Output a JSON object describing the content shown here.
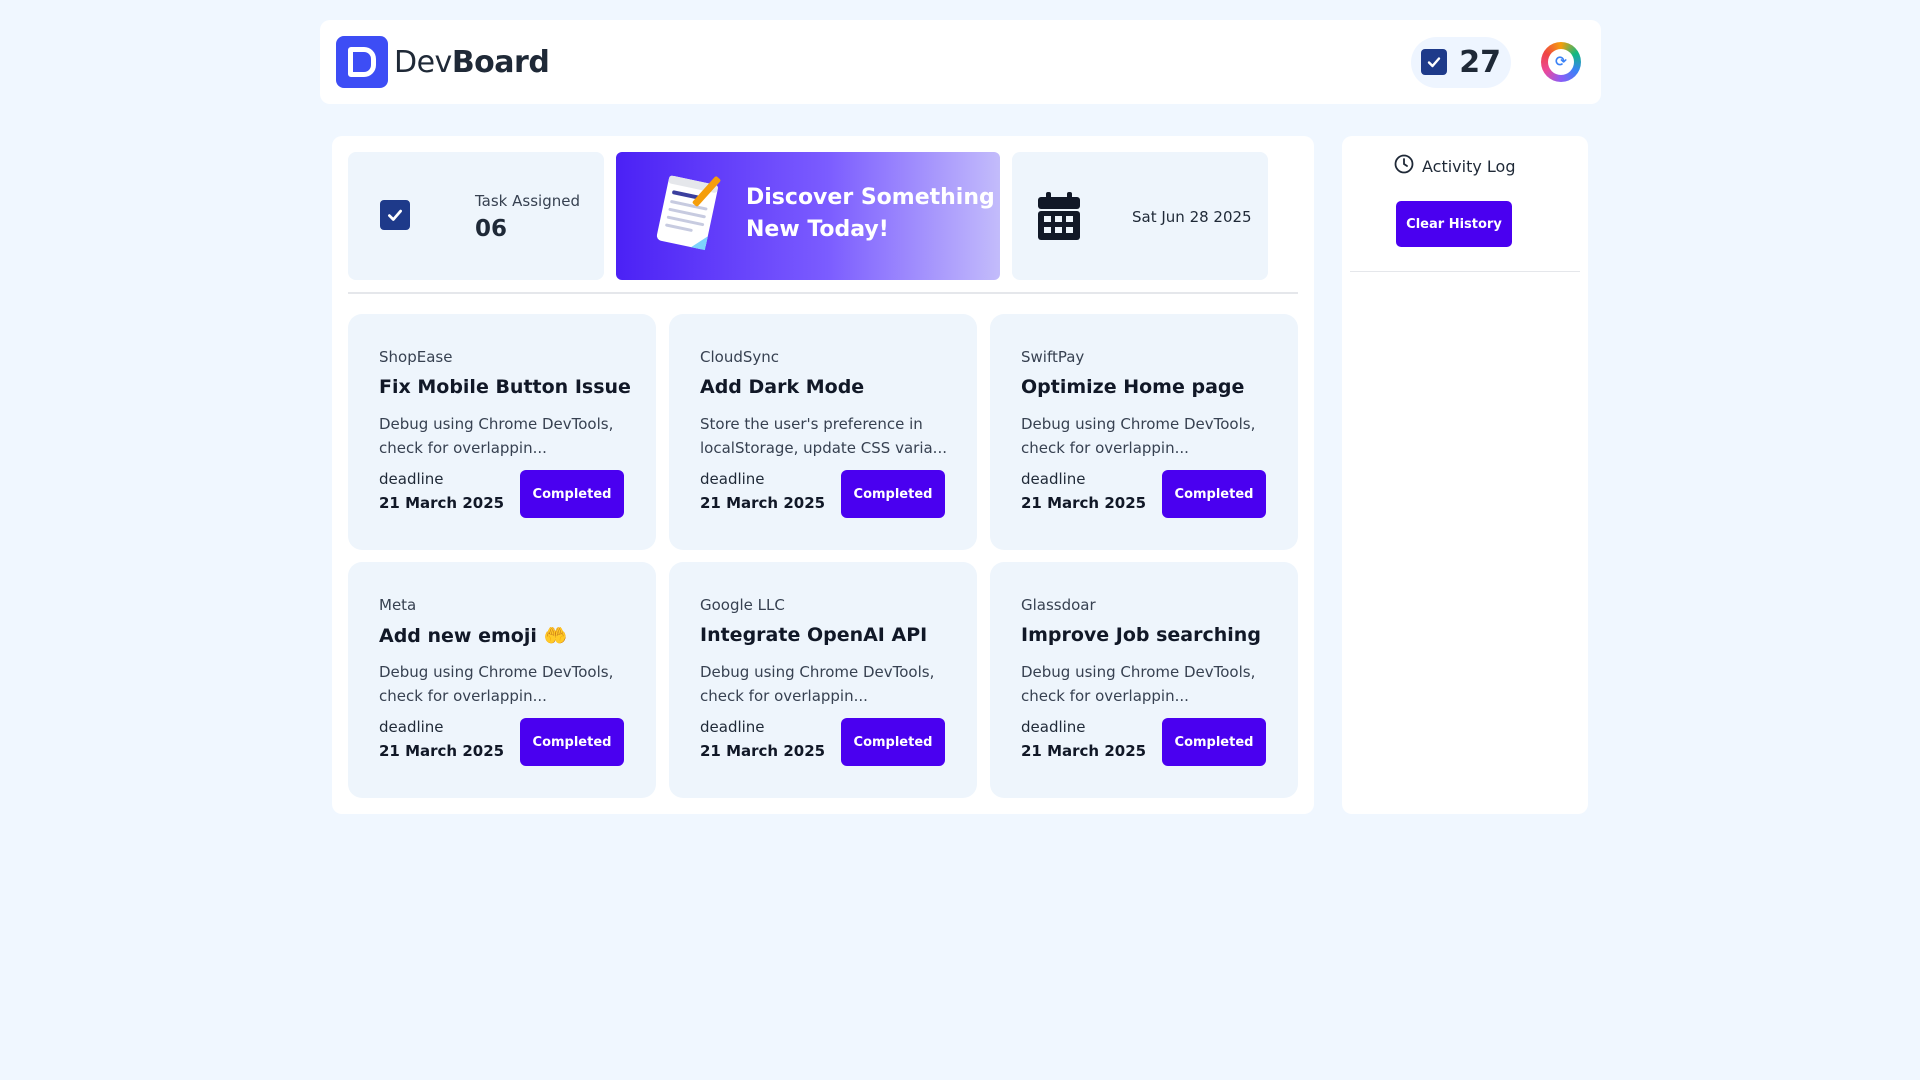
{
  "app": {
    "brand_prefix": "Dev",
    "brand_suffix": "Board",
    "header_count": "27"
  },
  "stats": {
    "task_label": "Task Assigned",
    "task_count": "06",
    "banner_text": "Discover Something New Today!",
    "date": "Sat Jun 28 2025"
  },
  "tasks": [
    {
      "company": "ShopEase",
      "title": "Fix Mobile Button Issue",
      "desc": "Debug using Chrome DevTools, check for overlappin...",
      "deadline_label": "deadline",
      "deadline": "21 March 2025",
      "status": "Completed"
    },
    {
      "company": "CloudSync",
      "title": "Add Dark Mode",
      "desc": "Store the user's preference in localStorage, update CSS varia...",
      "deadline_label": "deadline",
      "deadline": "21 March 2025",
      "status": "Completed"
    },
    {
      "company": "SwiftPay",
      "title": "Optimize Home page",
      "desc": "Debug using Chrome DevTools, check for overlappin...",
      "deadline_label": "deadline",
      "deadline": "21 March 2025",
      "status": "Completed"
    },
    {
      "company": "Meta",
      "title": "Add new emoji 🤲",
      "desc": "Debug using Chrome DevTools, check for overlappin...",
      "deadline_label": "deadline",
      "deadline": "21 March 2025",
      "status": "Completed"
    },
    {
      "company": "Google LLC",
      "title": "Integrate OpenAI API",
      "desc": "Debug using Chrome DevTools, check for overlappin...",
      "deadline_label": "deadline",
      "deadline": "21 March 2025",
      "status": "Completed"
    },
    {
      "company": "Glassdoar",
      "title": "Improve Job searching",
      "desc": "Debug using Chrome DevTools, check for overlappin...",
      "deadline_label": "deadline",
      "deadline": "21 March 2025",
      "status": "Completed"
    }
  ],
  "activity": {
    "title": "Activity Log",
    "clear_label": "Clear History"
  },
  "colors": {
    "accent": "#4a00f0",
    "brand": "#3d4df5",
    "navy": "#1e3a8a",
    "background": "#f0f7ff",
    "card": "#eef5fc"
  },
  "icons": [
    "logo-icon",
    "checkbox-icon",
    "avatar-icon",
    "notepad-icon",
    "calendar-icon",
    "clock-icon"
  ]
}
